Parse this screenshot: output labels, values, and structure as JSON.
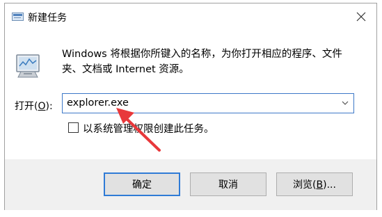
{
  "window": {
    "title": "新建任务",
    "description": "Windows 将根据你所键入的名称，为你打开相应的程序、文件夹、文档或 Internet 资源。"
  },
  "open_field": {
    "label_prefix": "打开(",
    "label_key": "O",
    "label_suffix": "):",
    "value": "explorer.exe"
  },
  "admin_checkbox": {
    "label": "以系统管理权限创建此任务。",
    "checked": false
  },
  "buttons": {
    "ok": "确定",
    "cancel": "取消",
    "browse_prefix": "浏览(",
    "browse_key": "B",
    "browse_suffix": ")..."
  },
  "icons": {
    "title": "run-icon",
    "content": "run-large-icon",
    "close": "close-icon",
    "dropdown": "chevron-down-icon",
    "annotation": "red-arrow"
  },
  "colors": {
    "focus_border": "#3c78c8",
    "default_button_border": "#2f7bd6",
    "footer_bg": "#f0f0f0",
    "annotation": "#e8383b"
  }
}
